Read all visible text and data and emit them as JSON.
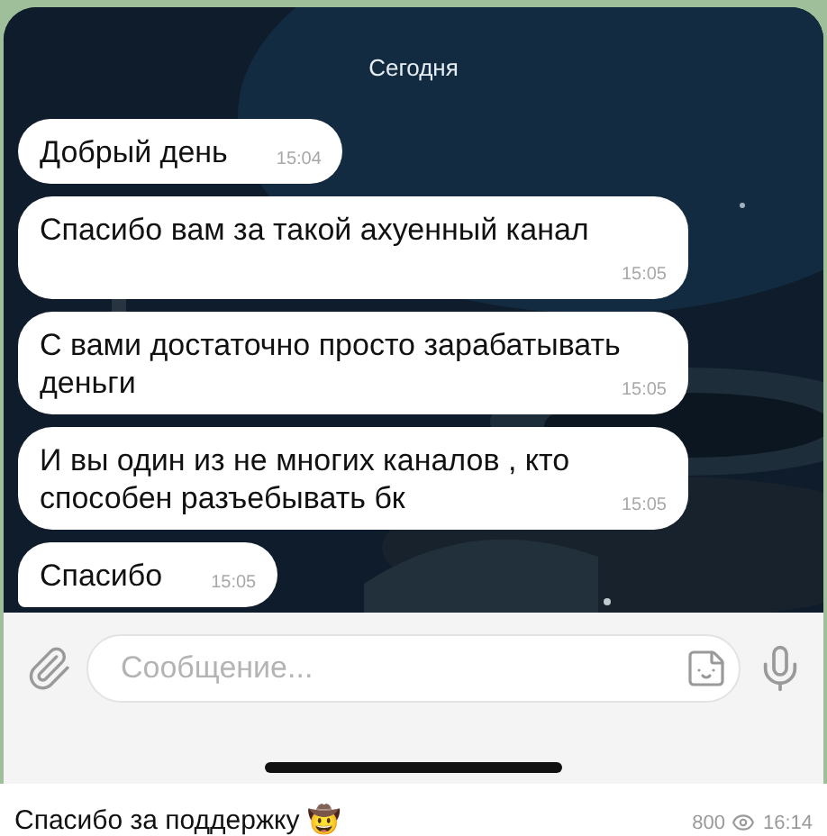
{
  "chat": {
    "date_label": "Сегодня",
    "messages": [
      {
        "text": "Добрый день",
        "time": "15:04",
        "tail": false
      },
      {
        "text": "Спасибо вам за такой ахуенный канал",
        "time": "15:05",
        "tail": false
      },
      {
        "text": "С вами достаточно просто зарабатывать деньги",
        "time": "15:05",
        "tail": false
      },
      {
        "text": "И вы один из не многих каналов , кто способен разъебывать бк",
        "time": "15:05",
        "tail": false
      },
      {
        "text": "Спасибо",
        "time": "15:05",
        "tail": true
      }
    ]
  },
  "composer": {
    "placeholder": "Сообщение..."
  },
  "post": {
    "caption": "Спасибо за поддержку 🤠",
    "views": "800",
    "time": "16:14"
  }
}
